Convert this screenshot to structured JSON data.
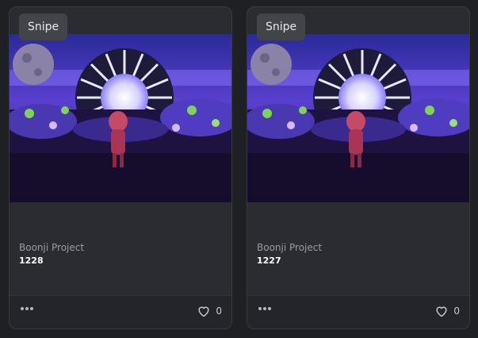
{
  "cards": [
    {
      "badge": "Snipe",
      "collection": "Boonji Project",
      "token_id": "1228",
      "likes": "0"
    },
    {
      "badge": "Snipe",
      "collection": "Boonji Project",
      "token_id": "1227",
      "likes": "0"
    }
  ],
  "icons": {
    "more": "more-horizontal-icon",
    "like": "heart-outline-icon"
  },
  "colors": {
    "card_bg": "#2b2c31",
    "badge_bg": "#43444b",
    "footer_bg": "#24252a"
  }
}
